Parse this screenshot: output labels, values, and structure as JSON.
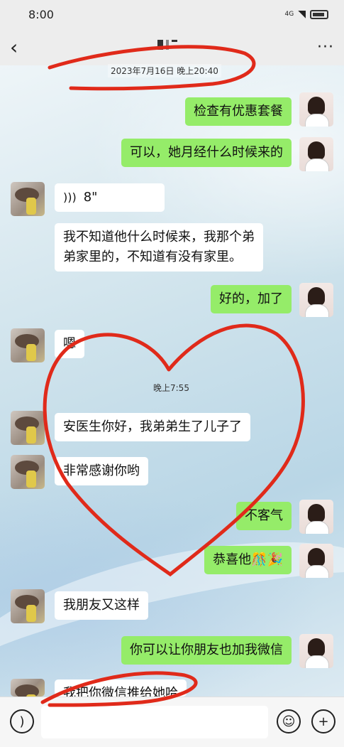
{
  "status_bar": {
    "time": "8:00",
    "network": "4G"
  },
  "header": {
    "back_icon": "chevron-left-icon",
    "more_icon": "more-icon"
  },
  "chat": {
    "timestamp_1": "2023年7月16日 晚上20:40",
    "timestamp_2": "晚上7:55",
    "messages": [
      {
        "side": "right",
        "text": "检查有优惠套餐"
      },
      {
        "side": "right",
        "text": "可以，她月经什么时候来的"
      },
      {
        "side": "left",
        "type": "voice",
        "text": "8\""
      },
      {
        "side": "left",
        "text_line1": "我不知道他什么时候来，我那个弟",
        "text_line2": "弟家里的，不知道有没有家里。"
      },
      {
        "side": "right",
        "text": "好的，加了"
      },
      {
        "side": "left",
        "text": "嗯"
      },
      {
        "side": "left",
        "text": "安医生你好，我弟弟生了儿子了"
      },
      {
        "side": "left",
        "text": "非常感谢你哟"
      },
      {
        "side": "right",
        "text": "不客气"
      },
      {
        "side": "right",
        "text": "恭喜他🎊🎉"
      },
      {
        "side": "left",
        "text": "我朋友又这样"
      },
      {
        "side": "right",
        "text": "你可以让你朋友也加我微信"
      },
      {
        "side": "left",
        "text": "我把你微信推给她哈"
      }
    ]
  },
  "input_bar": {
    "voice_icon": "voice-icon",
    "emoji_icon": "emoji-icon",
    "plus_icon": "plus-icon"
  },
  "colors": {
    "green_bubble": "#95ec69",
    "white_bubble": "#ffffff",
    "annotation": "#e02a1a"
  }
}
